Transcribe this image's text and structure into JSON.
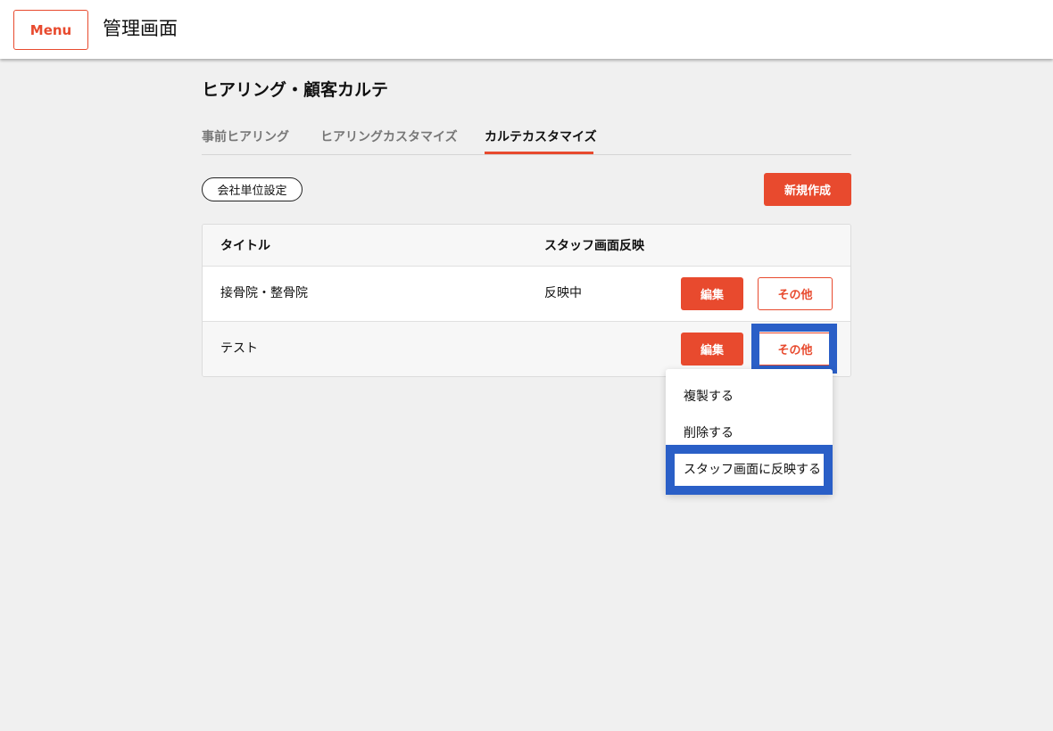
{
  "header": {
    "menu_label": "Menu",
    "title": "管理画面"
  },
  "page": {
    "heading": "ヒアリング・顧客カルテ",
    "tabs": [
      {
        "label": "事前ヒアリング",
        "active": false
      },
      {
        "label": "ヒアリングカスタマイズ",
        "active": false
      },
      {
        "label": "カルテカスタマイズ",
        "active": true
      }
    ],
    "company_setting_label": "会社単位設定",
    "new_button_label": "新規作成"
  },
  "table": {
    "columns": [
      "タイトル",
      "スタッフ画面反映"
    ],
    "rows": [
      {
        "title": "接骨院・整骨院",
        "reflection": "反映中",
        "edit_label": "編集",
        "other_label": "その他"
      },
      {
        "title": "テスト",
        "reflection": "",
        "edit_label": "編集",
        "other_label": "その他"
      }
    ]
  },
  "dropdown": {
    "items": [
      "複製する",
      "削除する",
      "スタッフ画面に反映する"
    ]
  },
  "colors": {
    "accent": "#e84a2e",
    "highlight": "#2a5fc7",
    "background": "#f0f0f0"
  }
}
